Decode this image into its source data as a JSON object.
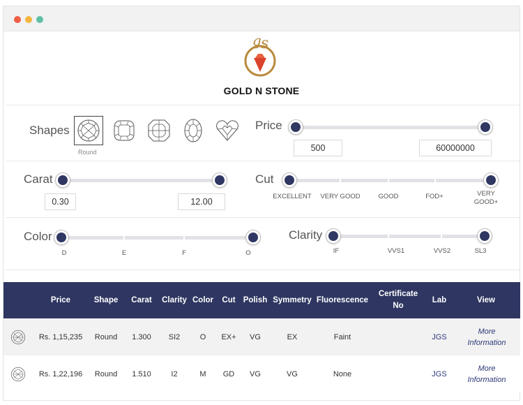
{
  "window": {
    "dots": [
      "close",
      "minimize",
      "maximize"
    ]
  },
  "brand": {
    "name": "GOLD N STONE",
    "logo_text": "gs"
  },
  "filters": {
    "shapes": {
      "label": "Shapes",
      "items": [
        {
          "name": "Round",
          "icon": "round-diamond-icon",
          "selected": true
        },
        {
          "name": "Cushion",
          "icon": "cushion-diamond-icon",
          "selected": false
        },
        {
          "name": "Asscher",
          "icon": "asscher-diamond-icon",
          "selected": false
        },
        {
          "name": "Oval",
          "icon": "oval-diamond-icon",
          "selected": false
        },
        {
          "name": "Heart",
          "icon": "heart-diamond-icon",
          "selected": false
        }
      ],
      "selected_caption": "Round"
    },
    "price": {
      "label": "Price",
      "min": "500",
      "max": "60000000"
    },
    "carat": {
      "label": "Carat",
      "min": "0.30",
      "max": "12.00"
    },
    "cut": {
      "label": "Cut",
      "steps": [
        "EXCELLENT",
        "VERY GOOD",
        "GOOD",
        "FOD+",
        "VERY GOOD+"
      ]
    },
    "color": {
      "label": "Color",
      "steps": [
        "D",
        "E",
        "F",
        "O"
      ]
    },
    "clarity": {
      "label": "Clarity",
      "steps": [
        "IF",
        "VVS1",
        "VVS2",
        "SL3"
      ]
    }
  },
  "table": {
    "headers": {
      "price": "Price",
      "shape": "Shape",
      "carat": "Carat",
      "clarity": "Clarity",
      "color": "Color",
      "cut": "Cut",
      "polish": "Polish",
      "symmetry": "Symmetry",
      "fluorescence": "Fluorescence",
      "certificate": "Certificate No",
      "lab": "Lab",
      "view": "View"
    },
    "rows": [
      {
        "price": "Rs. 1,15,235",
        "shape": "Round",
        "carat": "1.300",
        "clarity": "SI2",
        "color": "O",
        "cut": "EX+",
        "polish": "VG",
        "symmetry": "EX",
        "fluorescence": "Faint",
        "certificate": "",
        "lab": "JGS",
        "view": "More Information"
      },
      {
        "price": "Rs. 1,22,196",
        "shape": "Round",
        "carat": "1.510",
        "clarity": "I2",
        "color": "M",
        "cut": "GD",
        "polish": "VG",
        "symmetry": "VG",
        "fluorescence": "None",
        "certificate": "",
        "lab": "JGS",
        "view": "More Information"
      }
    ]
  },
  "colors": {
    "accent": "#2e3661",
    "slider_knob": "#2f3762",
    "link": "#2e3a7a",
    "logo_gold": "#b98a3e",
    "logo_gem": "#d9432b"
  }
}
